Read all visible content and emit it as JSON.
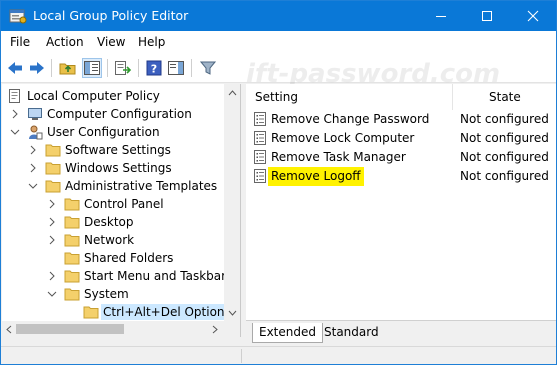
{
  "window": {
    "title": "Local Group Policy Editor",
    "titlebar_color": "#0a78d7"
  },
  "menu": {
    "items": [
      "File",
      "Action",
      "View",
      "Help"
    ]
  },
  "toolbar": {
    "icons": [
      "back-arrow-icon",
      "forward-arrow-icon",
      "up-folder-icon",
      "show-hide-tree-icon",
      "export-list-icon",
      "help-icon",
      "show-hide-action-pane-icon",
      "filter-icon"
    ]
  },
  "watermark": "ift-password.com",
  "tree": {
    "root": "Local Computer Policy",
    "computer_config": "Computer Configuration",
    "user_config": "User Configuration",
    "software_settings": "Software Settings",
    "windows_settings": "Windows Settings",
    "admin_templates": "Administrative Templates",
    "control_panel": "Control Panel",
    "desktop": "Desktop",
    "network": "Network",
    "shared_folders": "Shared Folders",
    "start_menu": "Start Menu and Taskbar",
    "system": "System",
    "ctrl_alt_del": "Ctrl+Alt+Del Options"
  },
  "details": {
    "col_setting": "Setting",
    "col_state": "State",
    "rows": [
      {
        "name": "Remove Change Password",
        "state": "Not configured"
      },
      {
        "name": "Remove Lock Computer",
        "state": "Not configured"
      },
      {
        "name": "Remove Task Manager",
        "state": "Not configured"
      },
      {
        "name": "Remove Logoff",
        "state": "Not configured"
      }
    ],
    "highlight_color": "#fff200"
  },
  "tabs": {
    "extended": "Extended",
    "standard": "Standard"
  }
}
